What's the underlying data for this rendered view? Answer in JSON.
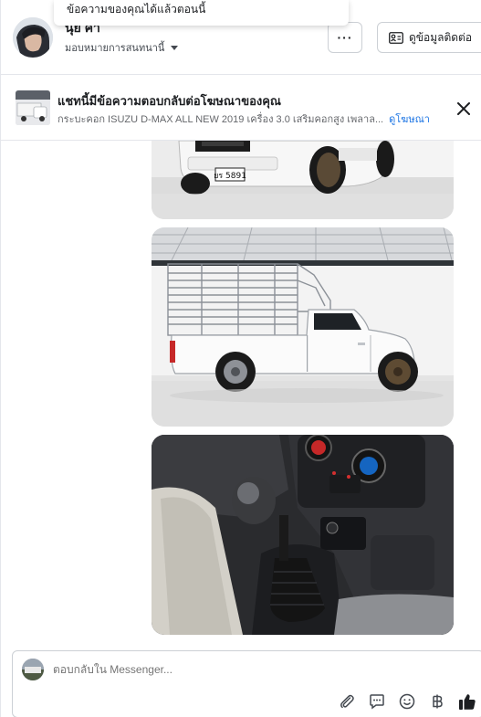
{
  "header": {
    "toast_text": "ข้อความของคุณได้แล้วตอนนี้",
    "user_name": "นุ่ย ค่ำ",
    "assign_text": "มอบหมายการสนทนานี้",
    "more_label": "···",
    "contact_label": "ดูข้อมูลติดต่อ"
  },
  "ad": {
    "title": "แชทนี้มีข้อความตอบกลับต่อโฆษณาของคุณ",
    "subtitle": "กระบะคอก ISUZU D-MAX ALL NEW 2019 เครื่อง 3.0 เสริมคอกสูง เพลาล...",
    "link": "ดูโฆษณา"
  },
  "composer": {
    "placeholder": "ตอบกลับใน Messenger..."
  },
  "icons": {
    "more": "more-icon",
    "contact": "id-card-icon",
    "close": "close-icon",
    "attach": "paperclip-icon",
    "saved_reply": "chat-bubble-icon",
    "emoji": "smiley-icon",
    "currency": "baht-icon",
    "like": "thumbs-up-icon"
  },
  "plate_text": "ยร 5891",
  "colors": {
    "accent": "#1b74e4",
    "border": "#ccd0d5",
    "text_secondary": "#65676b"
  }
}
